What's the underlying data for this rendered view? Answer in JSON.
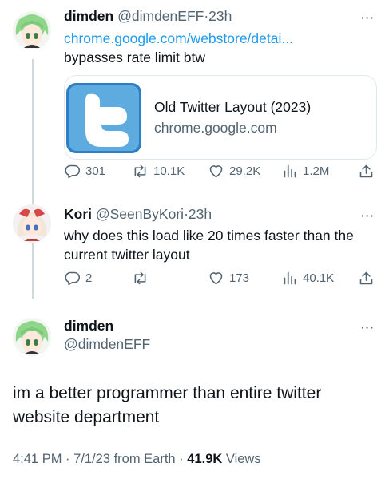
{
  "tweet1": {
    "name": "dimden",
    "handle": "@dimdenEFF",
    "time": "23h",
    "link": "chrome.google.com/webstore/detai...",
    "text": "bypasses rate limit btw",
    "card": {
      "title": "Old Twitter Layout (2023)",
      "domain": "chrome.google.com"
    },
    "stats": {
      "replies": "301",
      "retweets": "10.1K",
      "likes": "29.2K",
      "views": "1.2M"
    }
  },
  "tweet2": {
    "name": "Kori",
    "handle": "@SeenByKori",
    "time": "23h",
    "text": "why does this load like 20 times faster than the current twitter layout",
    "stats": {
      "replies": "2",
      "retweets": "",
      "likes": "173",
      "views": "40.1K"
    }
  },
  "tweet3": {
    "name": "dimden",
    "handle": "@dimdenEFF",
    "text": "im a better programmer than entire twitter website department",
    "meta_prefix": "4:41 PM · 7/1/23 from Earth · ",
    "views_count": "41.9K",
    "views_label": " Views"
  },
  "more_label": "···",
  "dot": "·",
  "colors": {
    "accent": "#1d9bf0",
    "secondary": "#536471",
    "twitter_logo_bg": "#5eacdf"
  },
  "icons": [
    "reply-icon",
    "retweet-icon",
    "like-icon",
    "views-icon",
    "share-icon",
    "twitter-bird-logo"
  ]
}
